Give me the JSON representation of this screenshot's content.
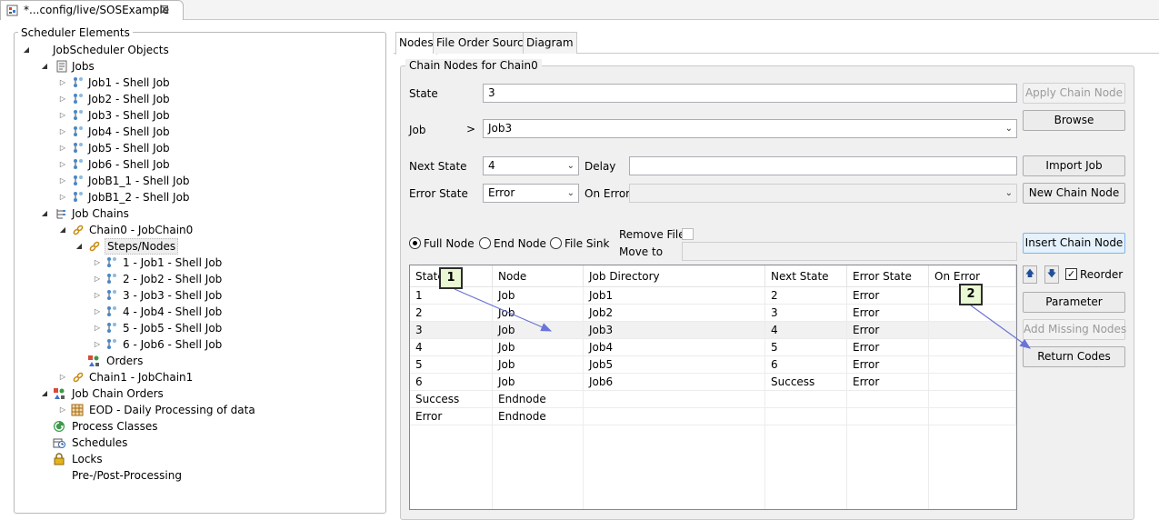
{
  "editor_tab": {
    "title": "*...config/live/SOSExample",
    "close": "⊠"
  },
  "left_panel": {
    "title": "Scheduler Elements",
    "tree": {
      "root": "JobScheduler Objects",
      "jobs_label": "Jobs",
      "jobs": [
        "Job1 - Shell Job",
        "Job2 - Shell Job",
        "Job3 - Shell Job",
        "Job4 - Shell Job",
        "Job5 - Shell Job",
        "Job6 - Shell Job",
        "JobB1_1 - Shell Job",
        "JobB1_2 - Shell Job"
      ],
      "job_chains_label": "Job Chains",
      "chain0": "Chain0 - JobChain0",
      "steps_nodes": "Steps/Nodes",
      "nodes": [
        "1 - Job1 - Shell Job",
        "2 - Job2 - Shell Job",
        "3 - Job3 - Shell Job",
        "4 - Job4 - Shell Job",
        "5 - Job5 - Shell Job",
        "6 - Job6 - Shell Job"
      ],
      "orders": "Orders",
      "chain1": "Chain1 - JobChain1",
      "job_chain_orders": "Job Chain Orders",
      "eod": "EOD - Daily Processing of data",
      "process_classes": "Process Classes",
      "schedules": "Schedules",
      "locks": "Locks",
      "pre_post": "Pre-/Post-Processing"
    }
  },
  "tabs": [
    "Nodes",
    "File Order Source",
    "Diagram"
  ],
  "group_title": "Chain Nodes for Chain0",
  "form": {
    "state_label": "State",
    "state_value": "3",
    "job_label": "Job",
    "job_arrow": ">",
    "job_value": "Job3",
    "next_state_label": "Next State",
    "next_state_value": "4",
    "delay_label": "Delay",
    "delay_value": "",
    "error_state_label": "Error State",
    "error_state_value": "Error",
    "on_error_label": "On Error",
    "on_error_value": "",
    "full_node": "Full Node",
    "end_node": "End Node",
    "file_sink": "File Sink",
    "remove_file": "Remove File",
    "move_to": "Move to",
    "reorder": "Reorder"
  },
  "buttons": {
    "apply": "Apply Chain Node",
    "browse": "Browse",
    "import_job": "Import Job",
    "new_chain_node": "New Chain Node",
    "insert_chain_node": "Insert Chain Node",
    "parameter": "Parameter",
    "add_missing_nodes": "Add Missing Nodes",
    "return_codes": "Return Codes",
    "up": "🡅",
    "down": "🡇"
  },
  "table": {
    "headers": [
      "State",
      "Node",
      "Job Directory",
      "Next State",
      "Error State",
      "On Error"
    ],
    "rows": [
      [
        "1",
        "Job",
        "Job1",
        "2",
        "Error",
        ""
      ],
      [
        "2",
        "Job",
        "Job2",
        "3",
        "Error",
        ""
      ],
      [
        "3",
        "Job",
        "Job3",
        "4",
        "Error",
        ""
      ],
      [
        "4",
        "Job",
        "Job4",
        "5",
        "Error",
        ""
      ],
      [
        "5",
        "Job",
        "Job5",
        "6",
        "Error",
        ""
      ],
      [
        "6",
        "Job",
        "Job6",
        "Success",
        "Error",
        ""
      ],
      [
        "Success",
        "Endnode",
        "",
        "",
        "",
        ""
      ],
      [
        "Error",
        "Endnode",
        "",
        "",
        "",
        ""
      ]
    ],
    "selected_row": 2
  },
  "callouts": [
    "1",
    "2"
  ],
  "colors": {
    "callout_bg": "#e9f7d3",
    "annotation_arrow": "#6b74d6",
    "selection": "#f1f1f1"
  }
}
